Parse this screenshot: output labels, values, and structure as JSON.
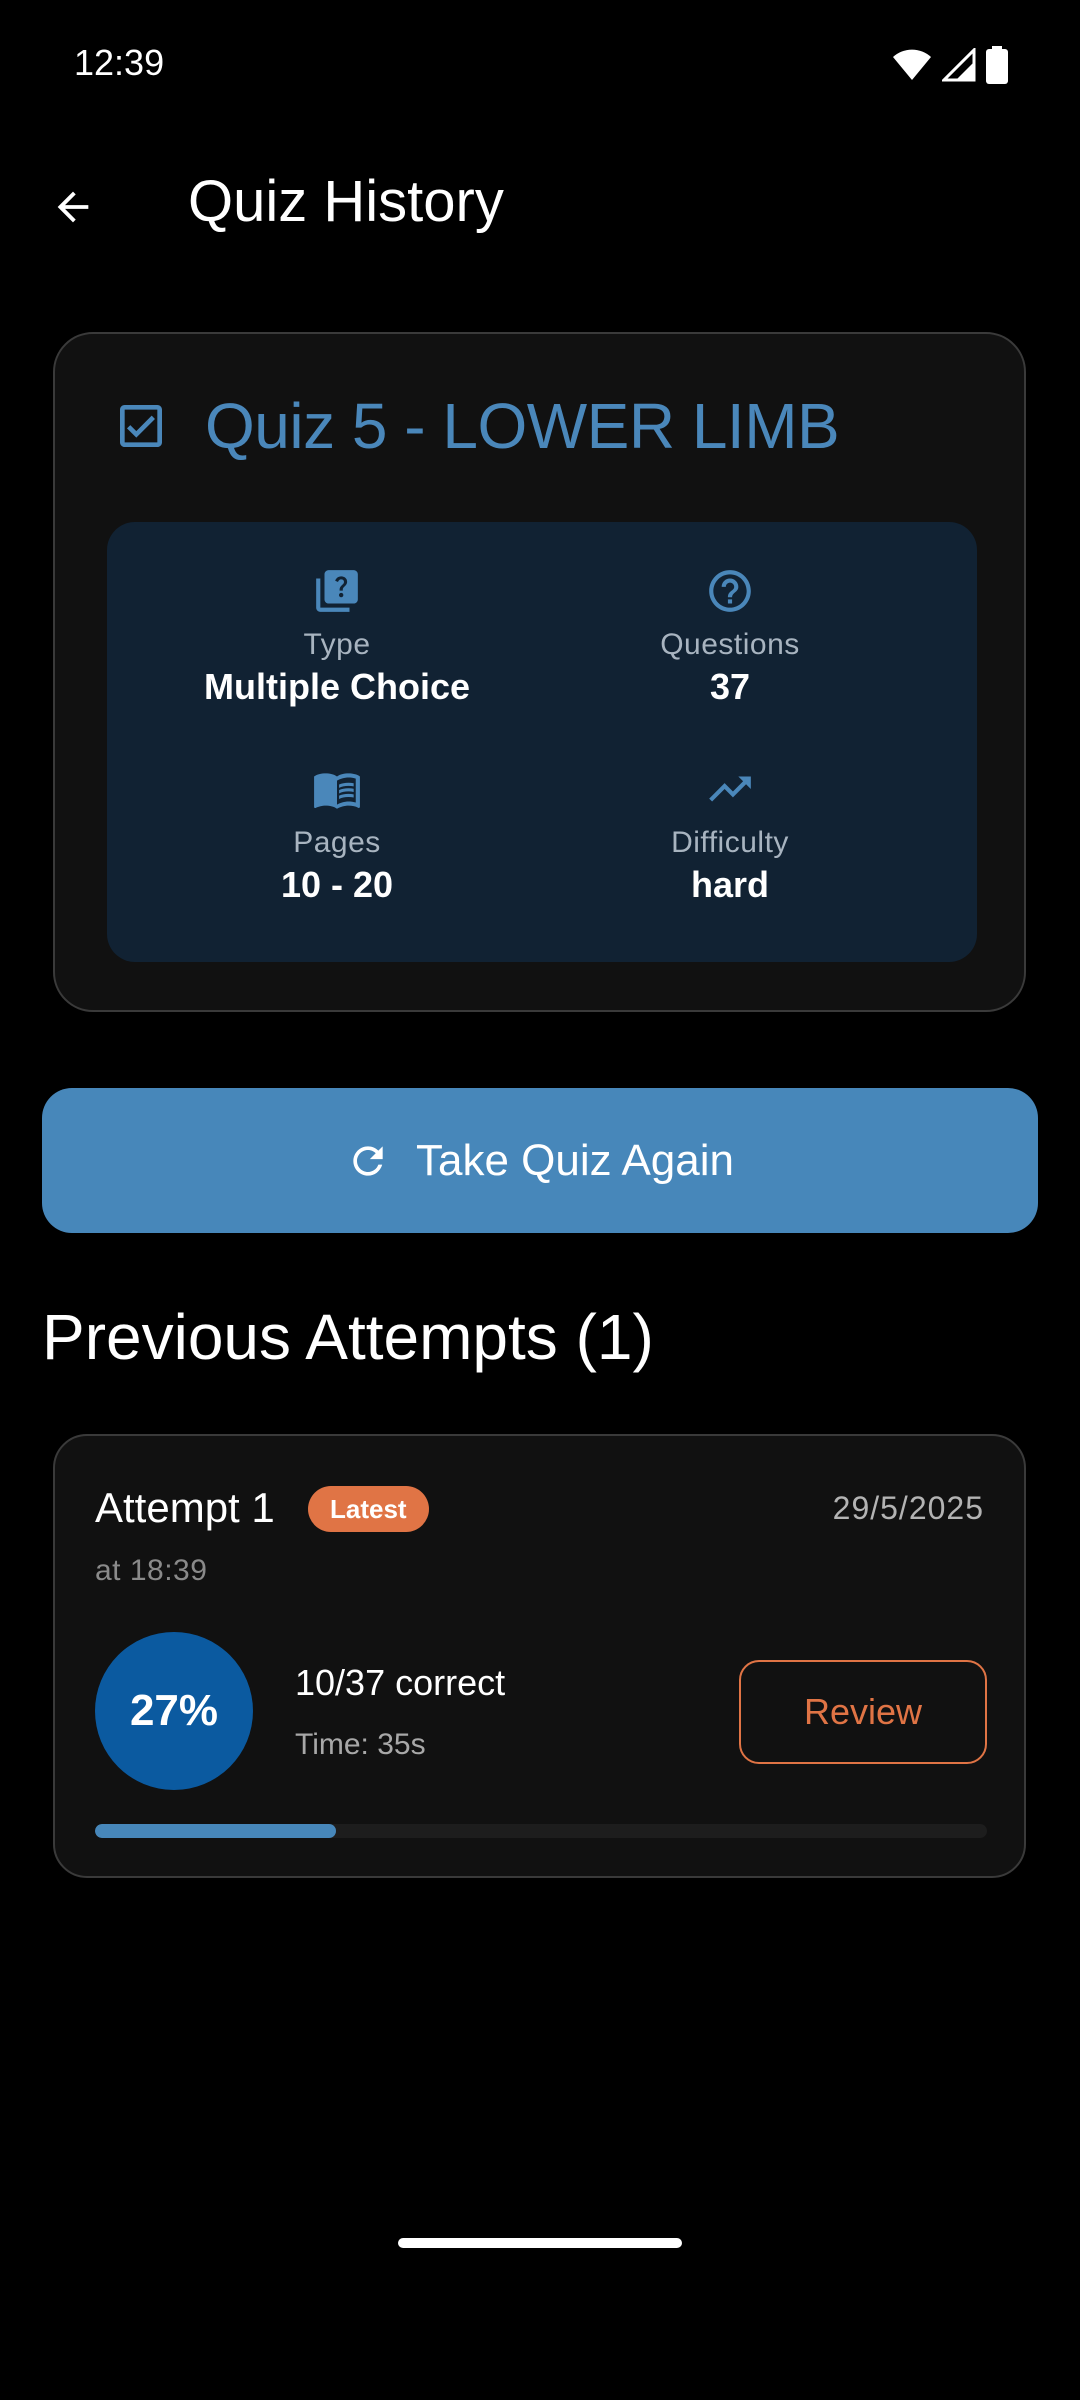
{
  "status_bar": {
    "time": "12:39",
    "icons": [
      "wifi-icon",
      "signal-icon",
      "battery-icon"
    ]
  },
  "app_bar": {
    "title": "Quiz History",
    "back_icon": "arrow-back-icon"
  },
  "quiz": {
    "title": "Quiz 5 - LOWER LIMB",
    "title_icon": "checkbox-icon",
    "title_color": "#4a87ba",
    "info": {
      "type": {
        "label": "Type",
        "value": "Multiple Choice",
        "icon": "quiz-icon"
      },
      "questions": {
        "label": "Questions",
        "value": "37",
        "icon": "help-circle-icon"
      },
      "pages": {
        "label": "Pages",
        "value": "10 - 20",
        "icon": "book-icon"
      },
      "difficulty": {
        "label": "Difficulty",
        "value": "hard",
        "icon": "trending-up-icon"
      }
    }
  },
  "actions": {
    "take_again_label": "Take Quiz Again",
    "take_again_icon": "refresh-icon",
    "primary_color": "#4787ba"
  },
  "attempts": {
    "heading": "Previous Attempts (1)",
    "items": [
      {
        "title": "Attempt 1",
        "badge": "Latest",
        "date": "29/5/2025",
        "time_of_day": "at 18:39",
        "score_percent": "27%",
        "correct": "10/37 correct",
        "duration": "Time: 35s",
        "review_label": "Review",
        "progress_fraction": 0.27,
        "accent_color": "#e07445"
      }
    ]
  }
}
